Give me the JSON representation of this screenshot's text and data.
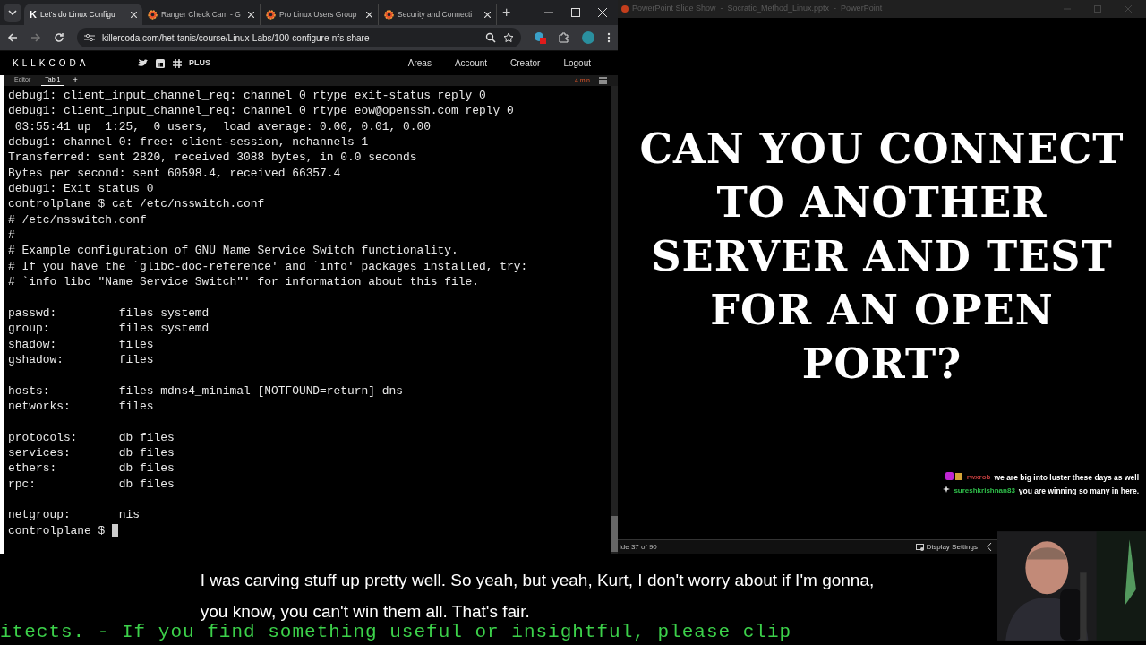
{
  "browser": {
    "tabs": [
      {
        "title": "Let's do Linux Configu",
        "selected": true,
        "kind": "letter",
        "favicon_text": "K"
      },
      {
        "title": "Ranger Check Cam - G",
        "selected": false,
        "kind": "gear"
      },
      {
        "title": "Pro Linux Users Group",
        "selected": false,
        "kind": "gear"
      },
      {
        "title": "Security and Connecti",
        "selected": false,
        "kind": "gear"
      }
    ],
    "new_tab": "+",
    "url": "killercoda.com/het-tanis/course/Linux-Labs/100-configure-nfs-share"
  },
  "site": {
    "logo": "KLLKCODA",
    "plus": "PLUS",
    "nav": [
      "Areas",
      "Account",
      "Creator",
      "Logout"
    ],
    "editor_tabs": [
      {
        "label": "Editor",
        "selected": false
      },
      {
        "label": "Tab 1",
        "selected": true
      }
    ],
    "add_tab": "+",
    "timer": "4 min"
  },
  "terminal": {
    "blocks": [
      [
        "debug1: client_input_channel_req: channel 0 rtype exit-status reply 0",
        "debug1: client_input_channel_req: channel 0 rtype eow@openssh.com reply 0",
        " 03:55:41 up  1:25,  0 users,  load average: 0.00, 0.01, 0.00",
        "debug1: channel 0: free: client-session, nchannels 1",
        "Transferred: sent 2820, received 3088 bytes, in 0.0 seconds",
        "Bytes per second: sent 60598.4, received 66357.4",
        "debug1: Exit status 0",
        "controlplane $ cat /etc/nsswitch.conf",
        "# /etc/nsswitch.conf",
        "#",
        "# Example configuration of GNU Name Service Switch functionality.",
        "# If you have the `glibc-doc-reference' and `info' packages installed, try:",
        "# `info libc \"Name Service Switch\"' for information about this file."
      ],
      [
        "passwd:         files systemd",
        "group:          files systemd",
        "shadow:         files",
        "gshadow:        files"
      ],
      [
        "hosts:          files mdns4_minimal [NOTFOUND=return] dns",
        "networks:       files"
      ],
      [
        "protocols:      db files",
        "services:       db files",
        "ethers:         db files",
        "rpc:            db files"
      ],
      [
        "netgroup:       nis"
      ]
    ],
    "prompt": "controlplane $ "
  },
  "powerpoint": {
    "title": "PowerPoint Slide Show  -  Socratic_Method_Linux.pptx  -  PowerPoint",
    "slide_lines": [
      "CAN YOU CONNECT",
      "TO ANOTHER",
      "SERVER AND TEST",
      "FOR AN OPEN",
      "PORT?"
    ],
    "slide_counter": "ide 37 of 90",
    "display_settings": "Display Settings"
  },
  "chat": [
    {
      "user": "rwxrob",
      "color": "#b83a3a",
      "badges": true,
      "message": "we are big into luster these days as well"
    },
    {
      "user": "sureshkrishnan83",
      "color": "#2fbf4a",
      "badges": false,
      "message": "you are winning so many in here."
    }
  ],
  "captions": [
    "I was carving stuff up pretty well. So yeah, but yeah, Kurt, I don't worry about if I'm gonna,",
    "you know, you can't win them all. That's fair."
  ],
  "ticker": "itects. - If you find something useful or insightful, please clip"
}
